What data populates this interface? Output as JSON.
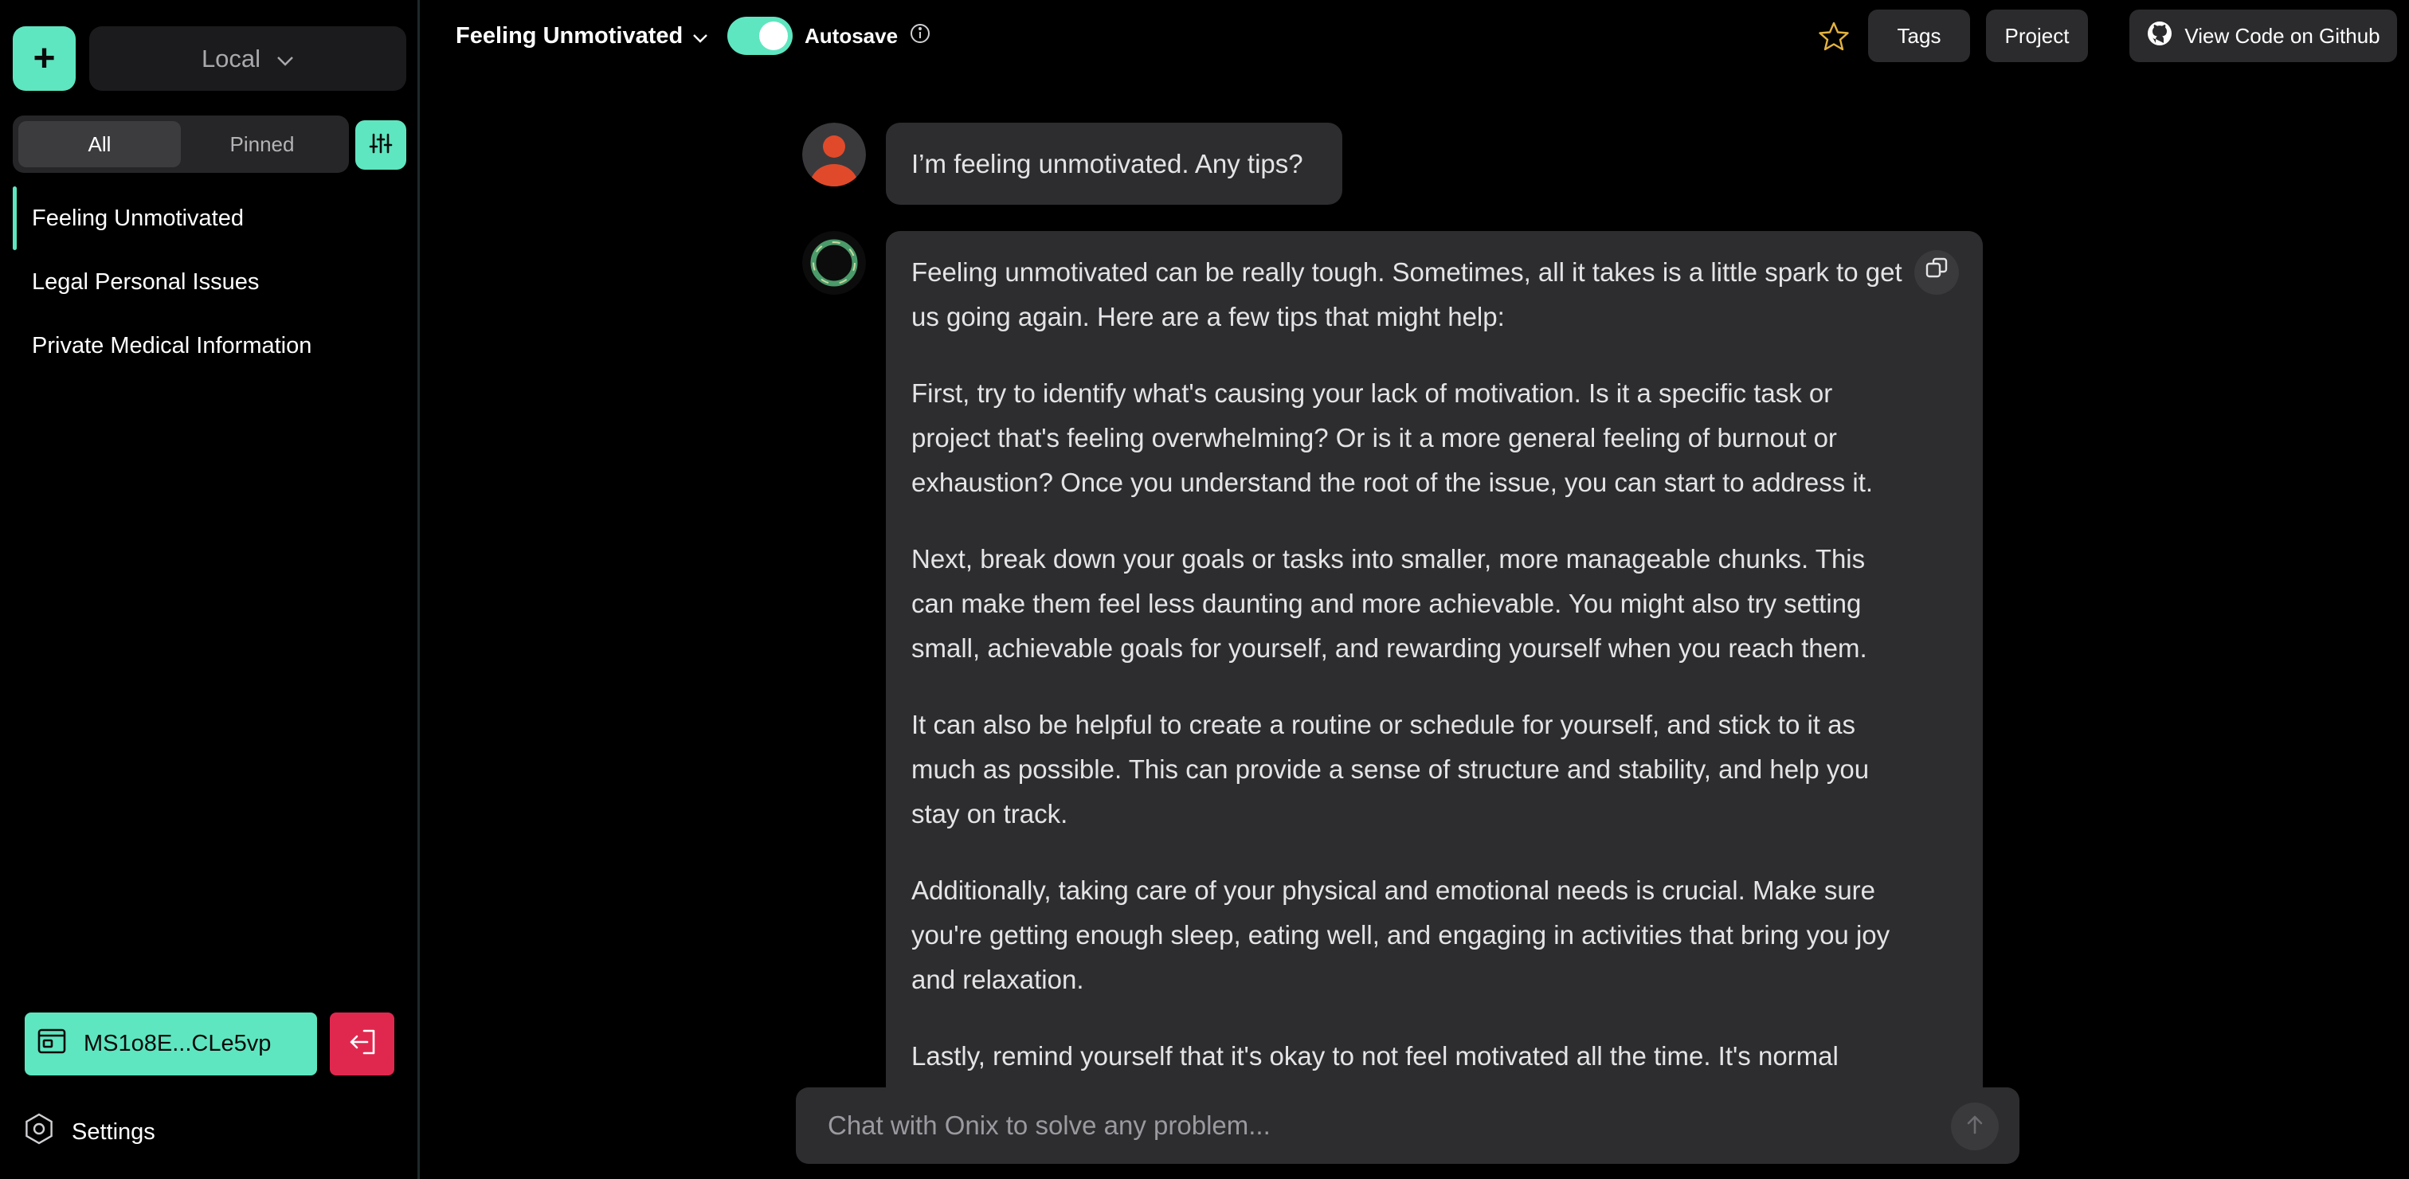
{
  "sidebar": {
    "new_chat_symbol": "+",
    "storage_select": "Local",
    "filter_tabs": {
      "all": "All",
      "pinned": "Pinned"
    },
    "chats": [
      {
        "title": "Feeling Unmotivated",
        "current": true
      },
      {
        "title": "Legal Personal Issues"
      },
      {
        "title": "Private Medical Information"
      }
    ],
    "wallet_address": "MS1o8E...CLe5vp",
    "settings_label": "Settings"
  },
  "header": {
    "conversation_title": "Feeling Unmotivated",
    "autosave_label": "Autosave",
    "autosave_on": true,
    "tags_label": "Tags",
    "project_label": "Project",
    "github_label": "View Code on Github"
  },
  "messages": {
    "user": "I’m feeling unmotivated. Any tips?",
    "assistant": [
      "Feeling unmotivated can be really tough. Sometimes, all it takes is a little spark to get us going again. Here are a few tips that might help:",
      "First, try to identify what's causing your lack of motivation. Is it a specific task or project that's feeling overwhelming? Or is it a more general feeling of burnout or exhaustion? Once you understand the root of the issue, you can start to address it.",
      "Next, break down your goals or tasks into smaller, more manageable chunks. This can make them feel less daunting and more achievable. You might also try setting small, achievable goals for yourself, and rewarding yourself when you reach them.",
      "It can also be helpful to create a routine or schedule for yourself, and stick to it as much as possible. This can provide a sense of structure and stability, and help you stay on track.",
      "Additionally, taking care of your physical and emotional needs is crucial. Make sure you're getting enough sleep, eating well, and engaging in activities that bring you joy and relaxation.",
      "Lastly, remind yourself that it's okay to not feel motivated all the time. It's normal"
    ]
  },
  "composer": {
    "placeholder": "Chat with Onix to solve any problem..."
  },
  "colors": {
    "accent": "#5ee6c0",
    "danger": "#e0284f",
    "bubble": "#2d2d30",
    "star": "#e3b341"
  }
}
